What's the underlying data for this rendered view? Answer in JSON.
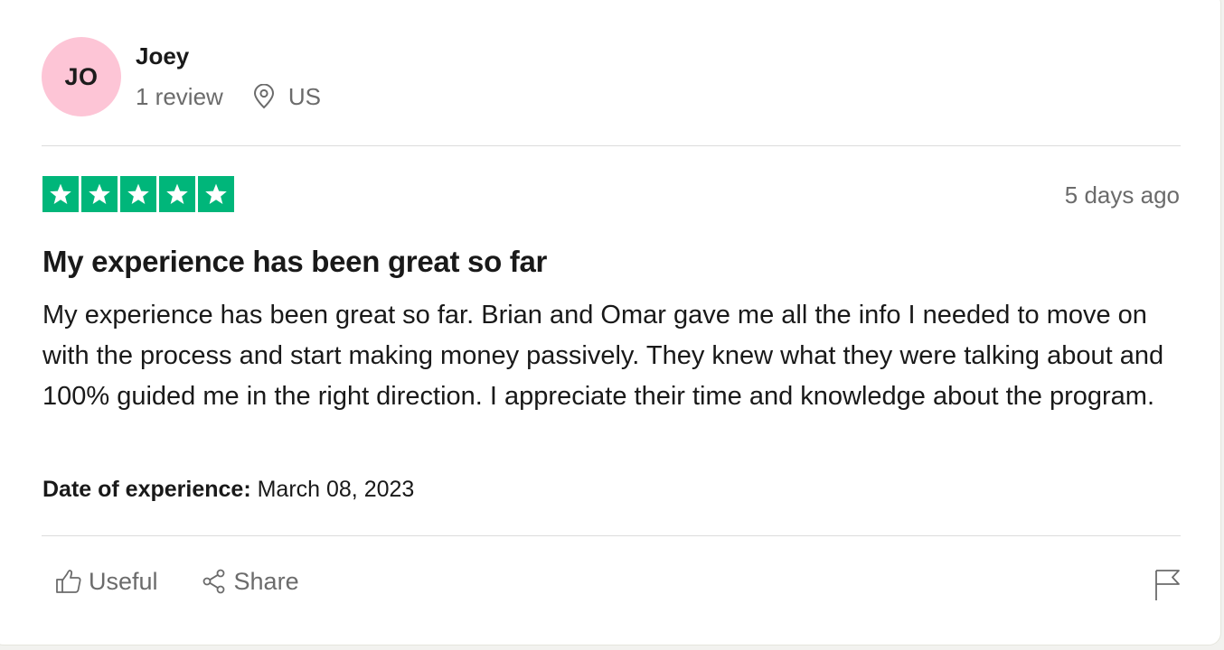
{
  "reviewer": {
    "initials": "JO",
    "name": "Joey",
    "review_count": "1 review",
    "location": "US",
    "avatar_color": "#fdc5d6"
  },
  "review": {
    "rating_stars": 5,
    "star_color": "#00b67a",
    "date_ago": "5 days ago",
    "title": "My experience has been great so far",
    "body": "My experience has been great so far. Brian and Omar gave me all the info I needed to move on with the process and start making money passively. They knew what they were talking about and 100% guided me in the right direction. I appreciate their time and knowledge about the program.",
    "experience_label": "Date of experience:",
    "experience_date": "March 08, 2023"
  },
  "actions": {
    "useful_label": "Useful",
    "share_label": "Share",
    "icons": [
      "thumbs-up-icon",
      "share-icon",
      "flag-icon",
      "location-pin-icon",
      "star-icon"
    ]
  }
}
